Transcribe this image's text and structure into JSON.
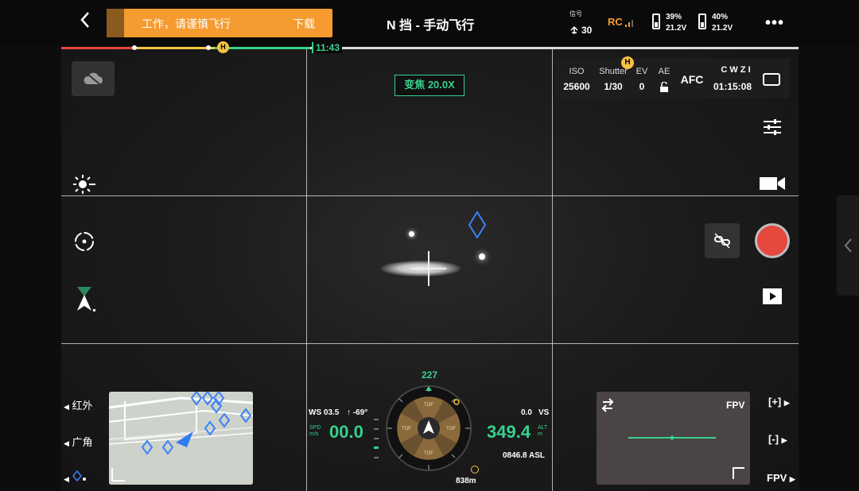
{
  "topbar": {
    "back_icon": "chevron-left-icon",
    "warning_text": "工作，请谨慎飞行",
    "warning_action": "下载",
    "flight_mode": "N 挡 - 手动飞行",
    "signal_label": "信号",
    "satellite_count": "30",
    "rc_label": "RC",
    "batteries": [
      {
        "percent": "39%",
        "voltage": "21.2V",
        "level": 0.39
      },
      {
        "percent": "40%",
        "voltage": "21.2V",
        "level": 0.4
      }
    ],
    "more_icon": "more-dots-icon"
  },
  "timeline": {
    "home_marker": "H",
    "time_remaining": "11:43"
  },
  "zoom": {
    "label": "变焦 20.0X"
  },
  "camera_params": {
    "iso_label": "ISO",
    "iso_value": "25600",
    "shutter_label": "Shutter",
    "shutter_value": "1/30",
    "ev_label": "EV",
    "ev_value": "0",
    "ae_label": "AE",
    "focus_mode": "AFC",
    "storage_label": "C W Z I",
    "record_time": "01:15:08",
    "home_marker": "H"
  },
  "left_controls": [
    "cloud-off-icon",
    "brightness-icon",
    "target-icon",
    "gimbal-direction-icon"
  ],
  "right_controls": [
    "settings-sliders-icon",
    "video-camera-icon",
    "link-icon",
    "record-button",
    "playback-icon"
  ],
  "lens_selector": {
    "items": [
      "红外",
      "广角"
    ]
  },
  "telemetry": {
    "wind_speed": "WS 03.5",
    "wind_dir": "↑ -69°",
    "speed_unit": "SPD m/s",
    "horizontal_speed": "00.0",
    "vertical_speed": "0.0",
    "vs_label": "VS",
    "altitude": "349.4",
    "alt_unit": "ALT m",
    "asl": "0846.8 ASL",
    "heading": "227",
    "distance": "838m",
    "sector_label": "TOF"
  },
  "fpv": {
    "label": "FPV",
    "swap_icon": "swap-icon",
    "zoom_in": "[+]",
    "zoom_out": "[-]",
    "fpv_button": "FPV"
  },
  "colors": {
    "accent_green": "#37d18d",
    "warning_orange": "#f59b2f",
    "record_red": "#e5483e",
    "waypoint_blue": "#3b82f6"
  }
}
